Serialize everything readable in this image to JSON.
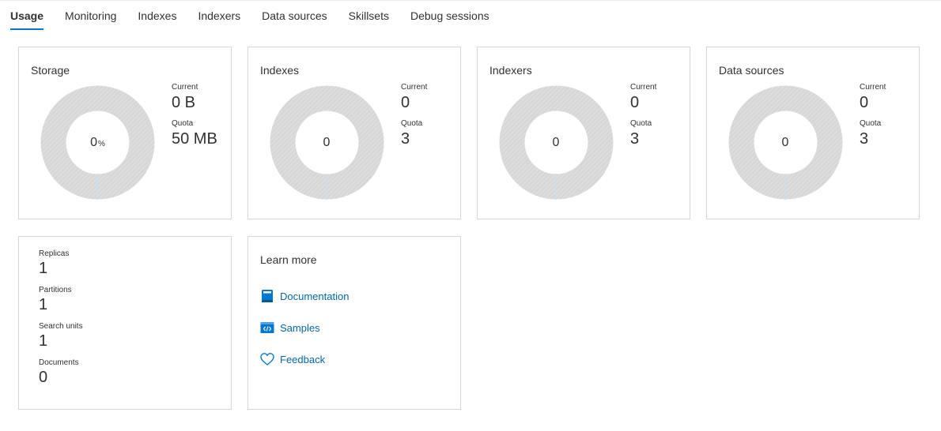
{
  "tabs": [
    "Usage",
    "Monitoring",
    "Indexes",
    "Indexers",
    "Data sources",
    "Skillsets",
    "Debug sessions"
  ],
  "active_tab": "Usage",
  "usage_cards": [
    {
      "title": "Storage",
      "center": "0",
      "center_unit": "%",
      "current_label": "Current",
      "current": "0 B",
      "quota_label": "Quota",
      "quota": "50 MB"
    },
    {
      "title": "Indexes",
      "center": "0",
      "center_unit": "",
      "current_label": "Current",
      "current": "0",
      "quota_label": "Quota",
      "quota": "3"
    },
    {
      "title": "Indexers",
      "center": "0",
      "center_unit": "",
      "current_label": "Current",
      "current": "0",
      "quota_label": "Quota",
      "quota": "3"
    },
    {
      "title": "Data sources",
      "center": "0",
      "center_unit": "",
      "current_label": "Current",
      "current": "0",
      "quota_label": "Quota",
      "quota": "3"
    }
  ],
  "service_stats": [
    {
      "label": "Replicas",
      "value": "1"
    },
    {
      "label": "Partitions",
      "value": "1"
    },
    {
      "label": "Search units",
      "value": "1"
    },
    {
      "label": "Documents",
      "value": "0"
    }
  ],
  "learn_more": {
    "title": "Learn more",
    "links": [
      {
        "label": "Documentation",
        "icon": "book-icon"
      },
      {
        "label": "Samples",
        "icon": "code-window-icon"
      },
      {
        "label": "Feedback",
        "icon": "heart-icon"
      }
    ]
  },
  "colors": {
    "accent": "#0078d4",
    "link": "#0067b8",
    "donut_track": "#d9d9d9",
    "card_border": "#d6d6d6"
  }
}
